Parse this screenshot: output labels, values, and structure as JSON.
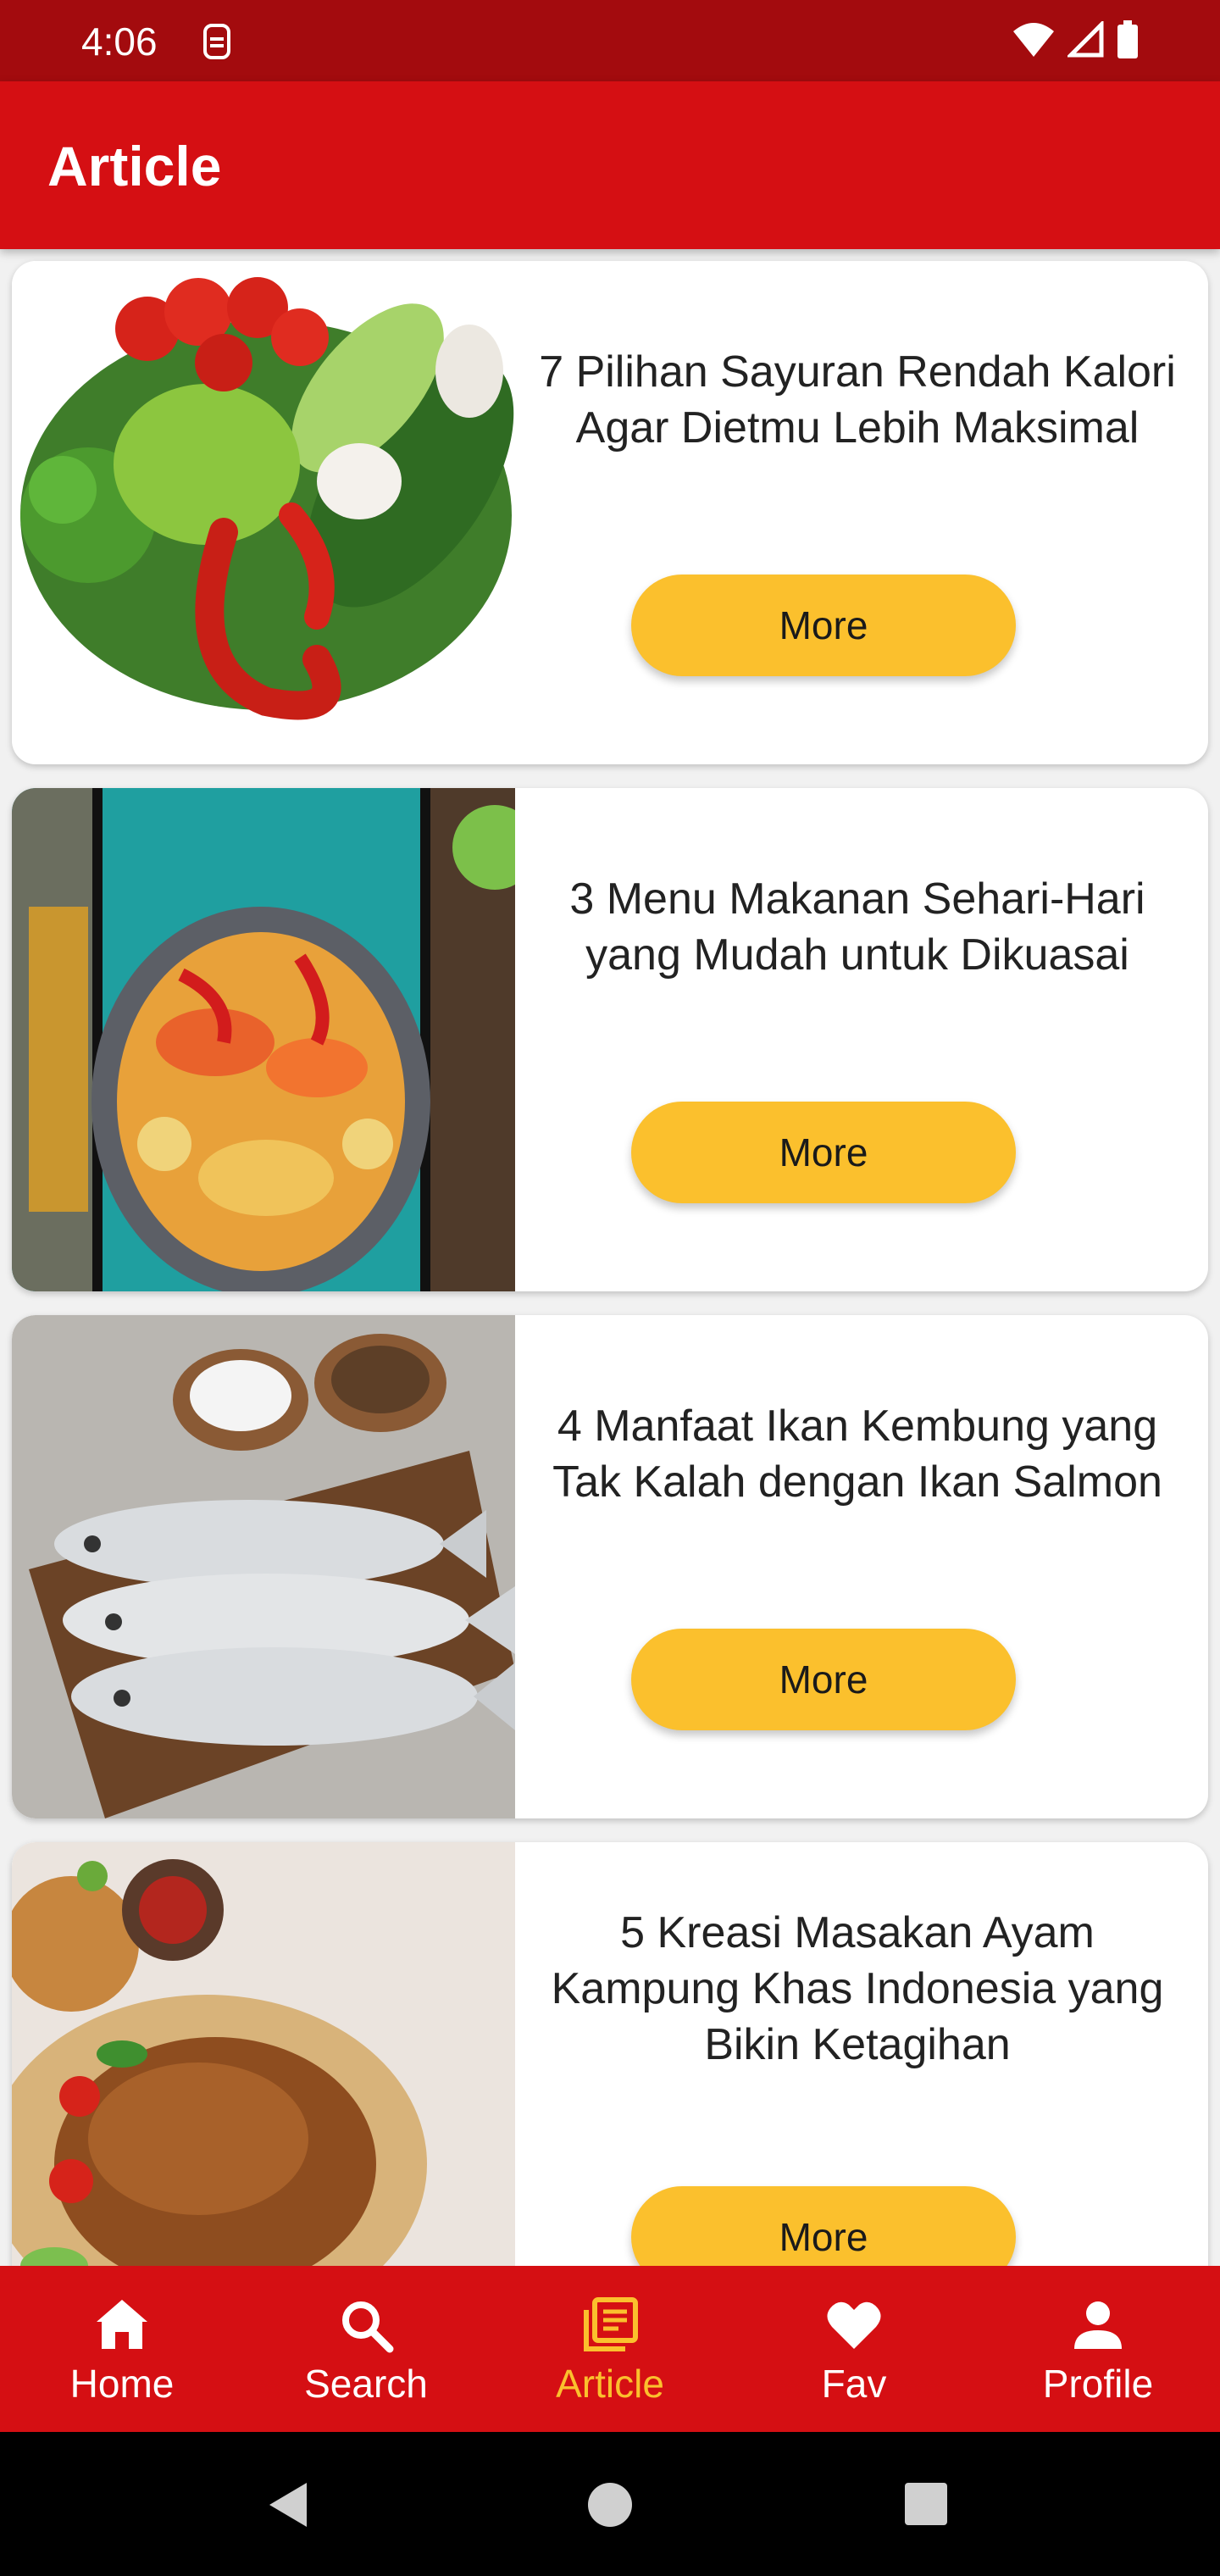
{
  "status_bar": {
    "time": "4:06"
  },
  "app_bar": {
    "title": "Article"
  },
  "articles": [
    {
      "title": "7 Pilihan Sayuran Rendah Kalori Agar Dietmu Lebih Maksimal",
      "button": "More",
      "image": "vegetables"
    },
    {
      "title": "3 Menu Makanan Sehari-Hari yang Mudah untuk Dikuasai",
      "button": "More",
      "image": "stir-fry"
    },
    {
      "title": "4 Manfaat Ikan Kembung yang Tak Kalah dengan Ikan Salmon",
      "button": "More",
      "image": "mackerel-fish"
    },
    {
      "title": "5 Kreasi Masakan Ayam Kampung Khas Indonesia yang Bikin Ketagihan",
      "button": "More",
      "image": "fried-chicken"
    }
  ],
  "bottom_nav": {
    "items": [
      {
        "label": "Home",
        "icon": "home-icon",
        "active": false
      },
      {
        "label": "Search",
        "icon": "search-icon",
        "active": false
      },
      {
        "label": "Article",
        "icon": "article-icon",
        "active": true
      },
      {
        "label": "Fav",
        "icon": "heart-icon",
        "active": false
      },
      {
        "label": "Profile",
        "icon": "person-icon",
        "active": false
      }
    ]
  },
  "colors": {
    "primary": "#d50f13",
    "status_bar": "#a30b0e",
    "accent": "#fbc02d"
  }
}
